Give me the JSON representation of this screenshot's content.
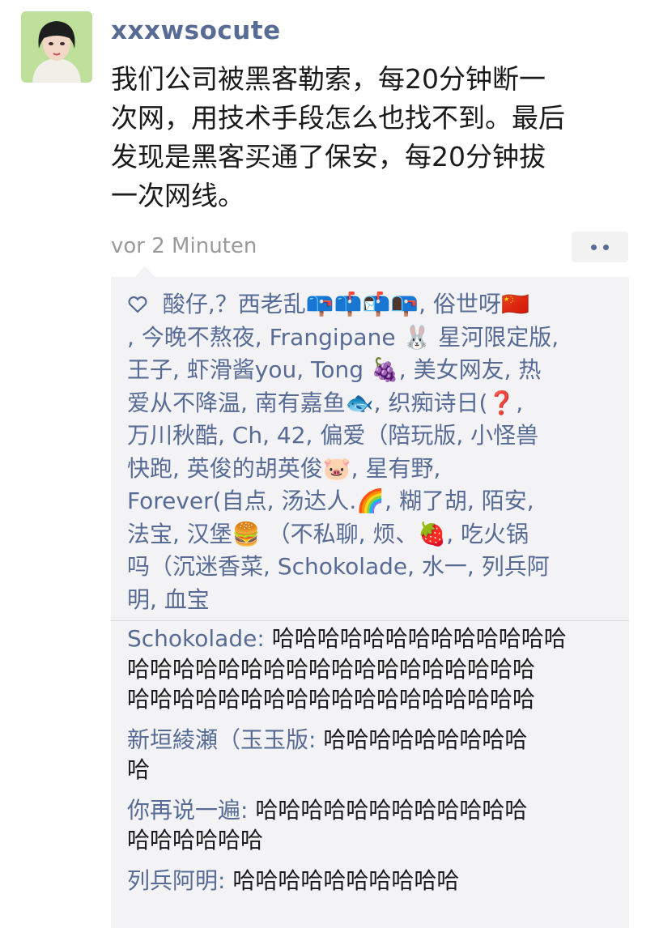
{
  "post": {
    "username": "xxxwsocute",
    "text_lines": [
      "我们公司被黑客勒索，每20分钟断一",
      "次网，用技术手段怎么也找不到。最后",
      "发现是黑客买通了保安，每20分钟拔",
      "一次网线。"
    ],
    "timestamp": "vor 2 Minuten"
  },
  "likes": {
    "icon": "heart-icon",
    "lines": [
      "酸仔,？西老乱📪📫📬📭, 俗世呀🇨🇳",
      ", 今晚不熬夜, Frangipane 🐰 星河限定版,",
      " 王子, 虾滑酱you, Tong 🍇, 美女网友, 热",
      "爱从不降温, 南有嘉鱼🐟, 织痴诗日(❓,",
      "万川秋酷, Ch, 42, 偏爱（陪玩版, 小怪兽",
      "快跑, 英俊的胡英俊🐷, 星有野,",
      "Forever(自点, 汤达人.🌈, 糊了胡, 陌安,",
      "法宝, 汉堡🍔 （不私聊, 烦、🍓, 吃火锅",
      "吗（沉迷香菜, Schokolade, 水一, 列兵阿",
      "明, 血宝"
    ]
  },
  "comments": [
    {
      "name": "Schokolade",
      "lines": [
        "哈哈哈哈哈哈哈哈哈哈哈哈哈",
        "哈哈哈哈哈哈哈哈哈哈哈哈哈哈哈哈哈哈",
        "哈哈哈哈哈哈哈哈哈哈哈哈哈哈哈哈哈哈"
      ]
    },
    {
      "name": "新垣綾瀬（玉玉版",
      "lines": [
        "哈哈哈哈哈哈哈哈哈",
        "哈"
      ]
    },
    {
      "name": "你再说一遍",
      "lines": [
        "哈哈哈哈哈哈哈哈哈哈哈哈",
        "哈哈哈哈哈哈"
      ]
    },
    {
      "name": "列兵阿明",
      "lines": [
        "哈哈哈哈哈哈哈哈哈哈"
      ]
    }
  ],
  "colors": {
    "link": "#576b95",
    "panel_bg": "#f3f3f5",
    "text": "#1a1a1a",
    "meta": "#9a9a9a"
  }
}
